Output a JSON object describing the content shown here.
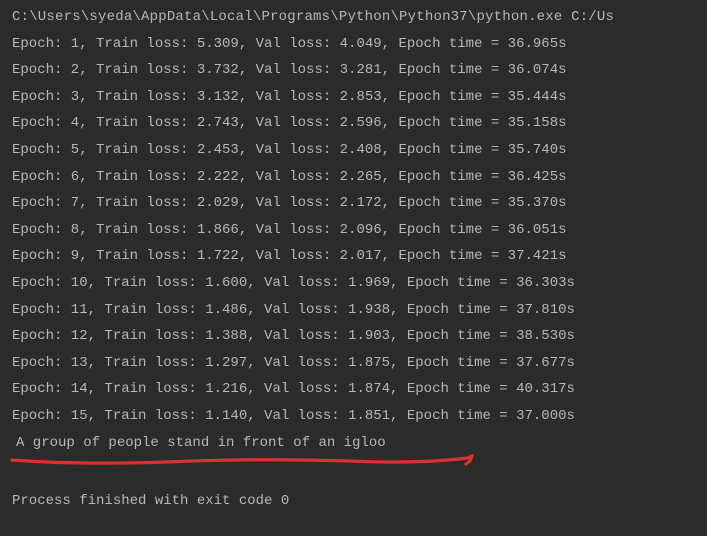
{
  "command_line": "C:\\Users\\syeda\\AppData\\Local\\Programs\\Python\\Python37\\python.exe C:/Us",
  "epochs": [
    {
      "epoch": 1,
      "train_loss": "5.309",
      "val_loss": "4.049",
      "time": "36.965s"
    },
    {
      "epoch": 2,
      "train_loss": "3.732",
      "val_loss": "3.281",
      "time": "36.074s"
    },
    {
      "epoch": 3,
      "train_loss": "3.132",
      "val_loss": "2.853",
      "time": "35.444s"
    },
    {
      "epoch": 4,
      "train_loss": "2.743",
      "val_loss": "2.596",
      "time": "35.158s"
    },
    {
      "epoch": 5,
      "train_loss": "2.453",
      "val_loss": "2.408",
      "time": "35.740s"
    },
    {
      "epoch": 6,
      "train_loss": "2.222",
      "val_loss": "2.265",
      "time": "36.425s"
    },
    {
      "epoch": 7,
      "train_loss": "2.029",
      "val_loss": "2.172",
      "time": "35.370s"
    },
    {
      "epoch": 8,
      "train_loss": "1.866",
      "val_loss": "2.096",
      "time": "36.051s"
    },
    {
      "epoch": 9,
      "train_loss": "1.722",
      "val_loss": "2.017",
      "time": "37.421s"
    },
    {
      "epoch": 10,
      "train_loss": "1.600",
      "val_loss": "1.969",
      "time": "36.303s"
    },
    {
      "epoch": 11,
      "train_loss": "1.486",
      "val_loss": "1.938",
      "time": "37.810s"
    },
    {
      "epoch": 12,
      "train_loss": "1.388",
      "val_loss": "1.903",
      "time": "38.530s"
    },
    {
      "epoch": 13,
      "train_loss": "1.297",
      "val_loss": "1.875",
      "time": "37.677s"
    },
    {
      "epoch": 14,
      "train_loss": "1.216",
      "val_loss": "1.874",
      "time": "40.317s"
    },
    {
      "epoch": 15,
      "train_loss": "1.140",
      "val_loss": "1.851",
      "time": "37.000s"
    }
  ],
  "caption_output": " A group of people stand in front of an igloo",
  "exit_line": "Process finished with exit code 0",
  "annotation_color": "#d8322f"
}
